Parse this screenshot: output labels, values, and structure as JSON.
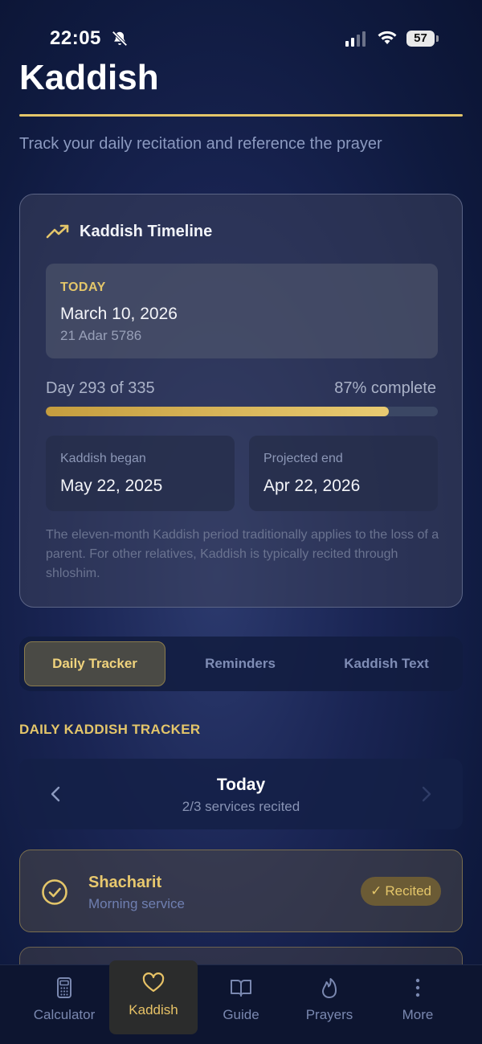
{
  "status_bar": {
    "time": "22:05",
    "battery": "57"
  },
  "page": {
    "title": "Kaddish",
    "subtitle": "Track your daily recitation and reference the prayer"
  },
  "timeline": {
    "title": "Kaddish Timeline",
    "today_label": "TODAY",
    "today_date": "March 10, 2026",
    "today_hebrew": "21 Adar 5786",
    "progress_text": "Day 293 of 335",
    "progress_percent_text": "87% complete",
    "progress_fraction": 0.875,
    "began_label": "Kaddish began",
    "began_value": "May 22, 2025",
    "end_label": "Projected end",
    "end_value": "Apr 22, 2026",
    "note": "The eleven-month Kaddish period traditionally applies to the loss of a parent. For other relatives, Kaddish is typically recited through shloshim."
  },
  "tabs": [
    {
      "label": "Daily Tracker",
      "active": true
    },
    {
      "label": "Reminders",
      "active": false
    },
    {
      "label": "Kaddish Text",
      "active": false
    }
  ],
  "tracker": {
    "section_label": "DAILY KADDISH TRACKER",
    "day_title": "Today",
    "day_subtitle": "2/3 services recited",
    "services": [
      {
        "name": "Shacharit",
        "subtitle": "Morning service",
        "badge": "Recited",
        "badge_icon": "✓"
      }
    ]
  },
  "bottom_nav": [
    {
      "label": "Calculator",
      "icon": "calculator-icon",
      "active": false
    },
    {
      "label": "Kaddish",
      "icon": "heart-icon",
      "active": true
    },
    {
      "label": "Guide",
      "icon": "book-icon",
      "active": false
    },
    {
      "label": "Prayers",
      "icon": "flame-icon",
      "active": false
    },
    {
      "label": "More",
      "icon": "more-vertical-icon",
      "active": false
    }
  ],
  "colors": {
    "accent_gold": "#e4c66a",
    "background": "#1a2554",
    "muted_text": "#8c9ac0"
  }
}
